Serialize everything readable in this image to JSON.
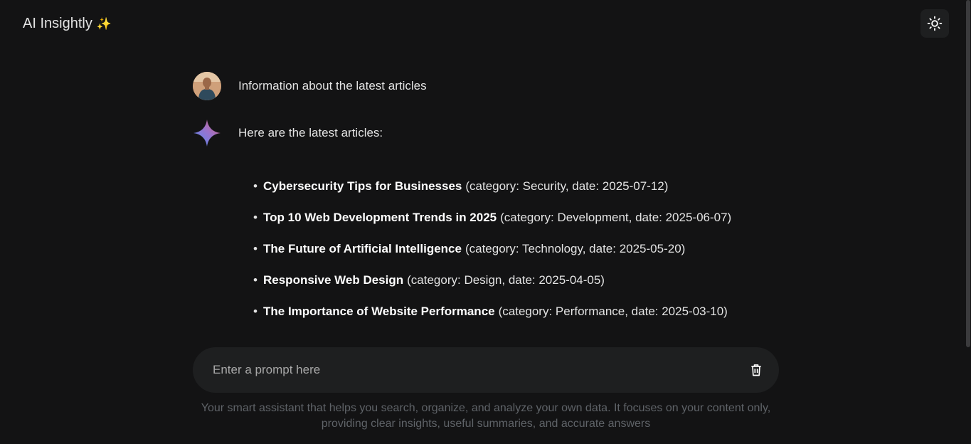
{
  "header": {
    "title": "AI Insightly",
    "title_emoji": "✨",
    "theme_toggle_icon": "sun-icon"
  },
  "conversation": {
    "user_message": "Information about the latest articles",
    "ai_intro": "Here are the latest articles:",
    "articles": [
      {
        "title": "Cybersecurity Tips for Businesses",
        "details": "(category: Security, date: 2025-07-12)"
      },
      {
        "title": "Top 10 Web Development Trends in 2025",
        "details": "(category: Development, date: 2025-06-07)"
      },
      {
        "title": "The Future of Artificial Intelligence",
        "details": "(category: Technology, date: 2025-05-20)"
      },
      {
        "title": "Responsive Web Design",
        "details": "(category: Design, date: 2025-04-05)"
      },
      {
        "title": "The Importance of Website Performance",
        "details": "(category: Performance, date: 2025-03-10)"
      }
    ]
  },
  "prompt": {
    "placeholder": "Enter a prompt here",
    "value": "",
    "clear_icon": "trash-icon"
  },
  "footer": {
    "note": "Your smart assistant that helps you search, organize, and analyze your own data. It focuses on your content only, providing clear insights, useful summaries, and accurate answers"
  },
  "colors": {
    "background": "#131314",
    "surface": "#1e1f20",
    "text": "#e3e3e3",
    "muted": "#5f6368",
    "gem_gradient": [
      "#4f8cf7",
      "#9b72cb",
      "#d96570"
    ]
  }
}
